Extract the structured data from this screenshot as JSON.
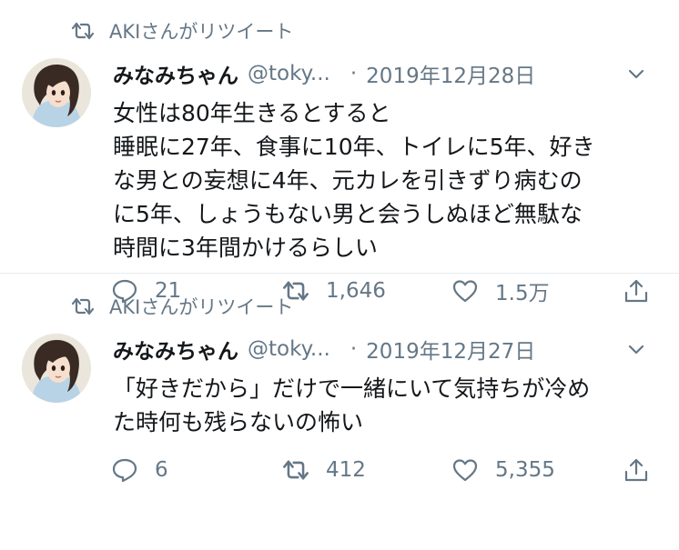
{
  "tweets": [
    {
      "retweeted_by": "AKIさんがリツイート",
      "author_name": "みなみちゃん",
      "handle": "@toky...",
      "separator": "·",
      "date": "2019年12月28日",
      "body_lines": [
        "女性は80年生きるとすると",
        "睡眠に27年、食事に10年、トイレに5年、好き",
        "な男との妄想に4年、元カレを引きずり病むの",
        "に5年、しょうもない男と会うしぬほど無駄な",
        "時間に3年間かけるらしい"
      ],
      "replies": "21",
      "retweets": "1,646",
      "likes": "1.5万"
    },
    {
      "retweeted_by": "AKIさんがリツイート",
      "author_name": "みなみちゃん",
      "handle": "@toky...",
      "separator": "·",
      "date": "2019年12月27日",
      "body_lines": [
        "「好きだから」だけで一緒にいて気持ちが冷め",
        "た時何も残らないの怖い"
      ],
      "replies": "6",
      "retweets": "412",
      "likes": "5,355"
    }
  ],
  "icons": {
    "retweet_context": "retweet-icon",
    "more": "chevron-down-icon",
    "reply": "reply-icon",
    "retweet": "retweet-icon",
    "like": "heart-icon",
    "share": "share-icon"
  },
  "colors": {
    "text": "#14171a",
    "secondary": "#657786",
    "divider": "#e6ecf0"
  }
}
